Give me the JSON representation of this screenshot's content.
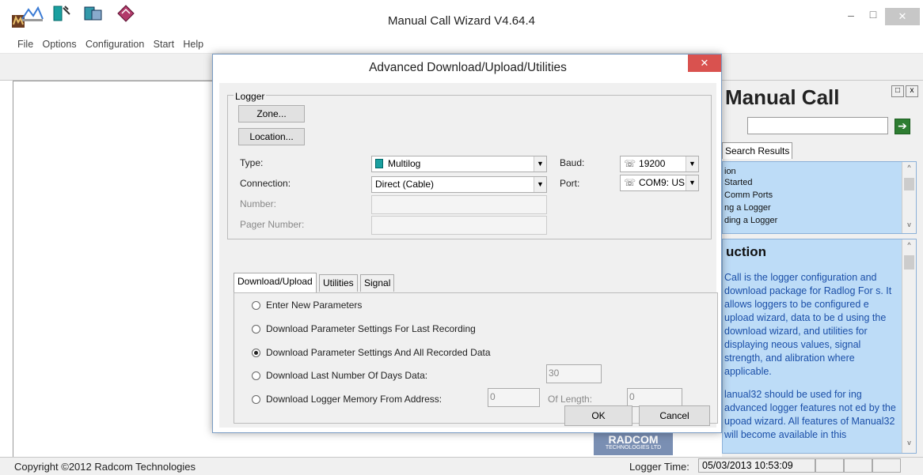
{
  "window": {
    "title": "Manual Call Wizard V4.64.4",
    "min_label": "–",
    "max_label": "□",
    "close_label": "✕"
  },
  "menu": [
    "File",
    "Options",
    "Configuration",
    "Start",
    "Help"
  ],
  "dialog": {
    "title": "Advanced Download/Upload/Utilities",
    "close_label": "✕",
    "logger_legend": "Logger",
    "zone_button": "Zone...",
    "location_button": "Location...",
    "type_label": "Type:",
    "type_value": "Multilog",
    "connection_label": "Connection:",
    "connection_value": "Direct (Cable)",
    "number_label": "Number:",
    "pager_label": "Pager Number:",
    "baud_label": "Baud:",
    "baud_value": "19200",
    "port_label": "Port:",
    "port_value": "COM9: US",
    "tabs": [
      "Download/Upload",
      "Utilities",
      "Signal"
    ],
    "options": [
      {
        "label": "Enter New Parameters",
        "selected": false
      },
      {
        "label": "Download Parameter Settings For Last Recording",
        "selected": false
      },
      {
        "label": "Download Parameter Settings And All Recorded Data",
        "selected": true
      },
      {
        "label": "Download Last Number Of Days Data:",
        "selected": false
      },
      {
        "label": "Download Logger Memory From Address:",
        "selected": false
      }
    ],
    "days_value": "30",
    "address_value": "0",
    "length_label": "Of Length:",
    "length_value": "0",
    "ok_button": "OK",
    "cancel_button": "Cancel"
  },
  "right_pane": {
    "title": "Manual Call",
    "restore_label": "□",
    "close_label": "x",
    "go_label": "➔",
    "search_tab": "Search Results",
    "list_items": [
      "ion",
      "Started",
      "Comm Ports",
      "ng a Logger",
      "ding a Logger"
    ],
    "help_heading": "uction",
    "help_paragraphs": [
      "Call is the logger configuration and download package for Radlog For s. It allows loggers to be configured e upload wizard, data to be d using the download wizard, and utilities for displaying neous values, signal strength, and alibration where applicable.",
      "lanual32 should be used for ing advanced logger features not ed by the upoad wizard. All features of Manual32 will become available in this"
    ],
    "logo_text": "RADCOM",
    "logo_sub": "TECHNOLOGIES LTD"
  },
  "status": {
    "copyright": "Copyright ©2012 Radcom Technologies",
    "logger_time_label": "Logger Time:",
    "logger_time_value": "05/03/2013 10:53:09"
  },
  "colors": {
    "accent": "#1b4fa8",
    "pane_bg": "#bddcf7",
    "dialog_close": "#d9524f"
  }
}
